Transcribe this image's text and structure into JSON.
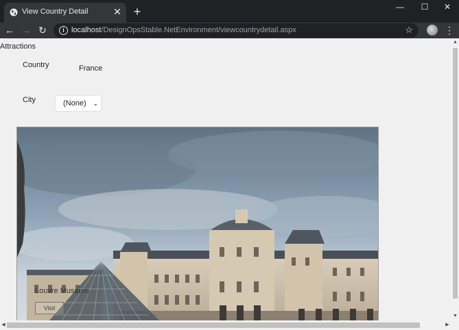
{
  "browser": {
    "tab_title": "View Country Detail",
    "tab_close": "✕",
    "new_tab": "+",
    "window_minimize": "—",
    "window_maximize": "☐",
    "window_close": "✕",
    "url_host": "localhost",
    "url_path": "/DesignOpsStable.NetEnvironment/viewcountrydetail.aspx",
    "info_glyph": "i",
    "bookmark_glyph": "☆",
    "menu_glyph": "⋮",
    "back_glyph": "←",
    "forward_glyph": "→",
    "reload_glyph": "↻"
  },
  "page": {
    "heading": "Attractions",
    "country_label": "Country",
    "country_value": "France",
    "city_label": "City",
    "city_selected": "(None)",
    "chevron": "⌄",
    "image_caption": "Louvre Museum",
    "image_button": "Visit"
  },
  "scroll": {
    "up": "▲",
    "down": "▼",
    "left": "◀",
    "right": "▶"
  }
}
